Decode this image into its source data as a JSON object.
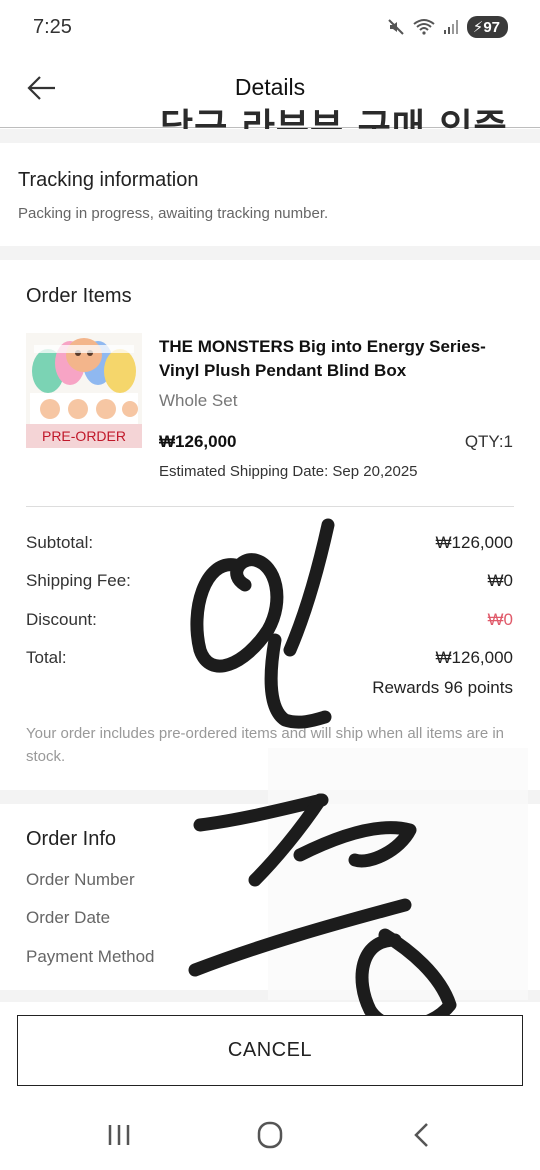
{
  "status_bar": {
    "time": "7:25",
    "battery": "97"
  },
  "header": {
    "title": "Details"
  },
  "overlay_caption": "당근 라부부 구매 인증",
  "tracking": {
    "title": "Tracking information",
    "status": "Packing in progress, awaiting tracking number."
  },
  "order_items": {
    "title": "Order Items",
    "item": {
      "badge": "PRE-ORDER",
      "name": "THE MONSTERS Big into Energy Series-Vinyl Plush Pendant Blind Box",
      "variant": "Whole Set",
      "price": "₩126,000",
      "qty": "QTY:1",
      "shipping_date": "Estimated Shipping Date: Sep 20,2025"
    }
  },
  "summary": {
    "subtotal_label": "Subtotal:",
    "subtotal_value": "₩126,000",
    "shipping_label": "Shipping Fee:",
    "shipping_value": "₩0",
    "discount_label": "Discount:",
    "discount_value": "₩0",
    "total_label": "Total:",
    "total_value": "₩126,000",
    "rewards": "Rewards 96 points"
  },
  "note": "Your order includes pre-ordered items and will ship when all items are in stock.",
  "order_info": {
    "title": "Order Info",
    "order_number_label": "Order Number",
    "order_date_label": "Order Date",
    "payment_method_label": "Payment Method"
  },
  "cancel_label": "CANCEL",
  "colors": {
    "discount": "#e05a6a",
    "badge_text": "#c0182a",
    "badge_bg": "#f4d4d6"
  },
  "icons": [
    "back-arrow-icon",
    "mute-icon",
    "wifi-icon",
    "signal-icon",
    "battery-icon",
    "recents-icon",
    "home-icon",
    "nav-back-icon"
  ]
}
